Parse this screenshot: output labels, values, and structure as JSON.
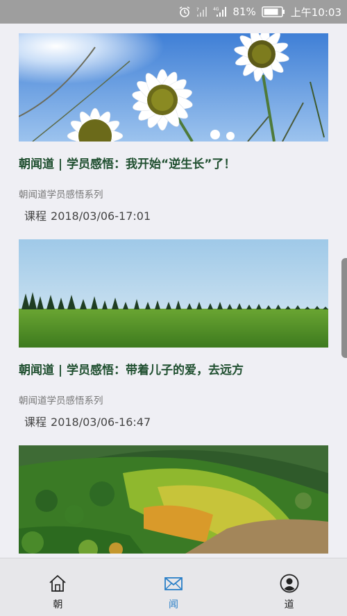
{
  "status_bar": {
    "battery": "81%",
    "time": "上午10:03",
    "network": "4G"
  },
  "feed": [
    {
      "title": "朝闻道 | 学员感悟：我开始“逆生长”了！",
      "series": "朝闻道学员感悟系列",
      "category": "课程",
      "datetime": "2018/03/06-17:01",
      "image": "daisies"
    },
    {
      "title": "朝闻道 | 学员感悟：带着儿子的爱，去远方",
      "series": "朝闻道学员感悟系列",
      "category": "课程",
      "datetime": "2018/03/06-16:47",
      "image": "meadow-treeline"
    },
    {
      "image": "autumn-forest-hill"
    }
  ],
  "tabs": [
    {
      "label": "朝",
      "icon": "home-icon",
      "active": false
    },
    {
      "label": "闻",
      "icon": "mail-icon",
      "active": true
    },
    {
      "label": "道",
      "icon": "person-icon",
      "active": false
    }
  ],
  "colors": {
    "active_tab": "#2a7fc7",
    "title": "#1f4f2f",
    "status_bar": "#9e9e9e"
  }
}
